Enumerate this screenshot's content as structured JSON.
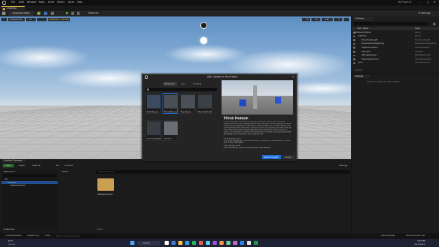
{
  "menu": {
    "items": [
      "File",
      "Edit",
      "Window",
      "Tools",
      "Build",
      "Select",
      "Actor",
      "Help"
    ],
    "project_name": "MyProject2"
  },
  "map_tab": {
    "label": "Untitled"
  },
  "main_toolbar": {
    "mode": "Selection Mode",
    "platforms": "Platforms"
  },
  "viewport": {
    "perspective": "Perspective",
    "lit": "Lit",
    "scalability": "Scalability: Cinematic",
    "grid_value": "10",
    "angle_value": "10°",
    "scale_value": "0.25",
    "speed_value": "4"
  },
  "outliner": {
    "tab": "Outliner",
    "col_label": "Item Label",
    "col_type": "Type",
    "rows": [
      {
        "label": "Untitled (Editor)",
        "type": "World"
      },
      {
        "label": "Lighting",
        "type": "Folder"
      },
      {
        "label": "DirectionalLight",
        "type": "DirectionalLight"
      },
      {
        "label": "ExponentialHeightFog",
        "type": "ExponentialHeightFog"
      },
      {
        "label": "SkyAtmosphere",
        "type": "SkyAtmosphere"
      },
      {
        "label": "SkyLight",
        "type": "SkyLight"
      },
      {
        "label": "SM_SkySphere",
        "type": "StaticMeshActor"
      },
      {
        "label": "VolumetricCloud",
        "type": "VolumetricCloud"
      },
      {
        "label": "Floor",
        "type": "StaticMeshActor"
      }
    ],
    "footer": "9 actors"
  },
  "details": {
    "tab": "Details",
    "empty": "Select an object to view details."
  },
  "content_browser": {
    "tab": "Content Browser",
    "add": "Add",
    "import": "Import",
    "save_all": "Save All",
    "path_all": "All",
    "path_content": "Content",
    "settings": "Settings",
    "tree_root": "MyProject2",
    "tree_all": "All",
    "tree_content": "Content",
    "tree_starter": "StarterContent",
    "filters": "Filters",
    "search_placeholder": "Search Content",
    "folder_name": "StarterContent",
    "item_count": "1 item",
    "collections": "Collections"
  },
  "status": {
    "content_drawer": "Content Drawer",
    "output_log": "Output Log",
    "cmd": "Cmd",
    "console_placeholder": "Enter Console Command",
    "derived_data": "Derived Data",
    "source_control": "Source Control Off"
  },
  "taskbar": {
    "weather_temp": "61°F",
    "weather_desc": "Cloudy",
    "search": "Search",
    "time": "4:07 PM",
    "date": "2/19/2024"
  },
  "dialog": {
    "title": "Add Content to the Project",
    "tabs": [
      "Blueprint",
      "C++",
      "Content"
    ],
    "active_tab": "Blueprint",
    "search_placeholder": "",
    "templates": [
      {
        "name": "First Person"
      },
      {
        "name": "Third Person"
      },
      {
        "name": "Top Down"
      },
      {
        "name": "Handheld AR"
      },
      {
        "name": "Virtual Reality"
      },
      {
        "name": "Vehicle"
      }
    ],
    "selected": "Third Person",
    "preview_title": "Third Person",
    "preview_desc": "The third person feature is a playable character where the camera is positioned behind and slightly above the character. As the character moves using mouse, keyboard, controller or virtual joystick on a touch device, the camera follows the character, observing from an over-the-shoulder point of view. This perspective emphasizes the main character and is popular in action and adventure games. The feature also includes several objects that the player can jump upon, and push around.",
    "asset_type_label": "Asset Type(s) Used:",
    "asset_types": "Animation Sequence, Animation Blueprint, Skeleton, Skeletal Mesh, Control Rig, IK Rig, Retargeter",
    "class_type_label": "Class Type(s) Used:",
    "class_types": "Pawn/Character, EnhancedInputActions, GameMode",
    "add_button": "Add to Project",
    "cancel_button": "Cancel"
  },
  "colors": {
    "accent_blue": "#1f6fd6",
    "ue_bg": "#151515",
    "panel": "#1c1c1c",
    "folder": "#c9a052"
  }
}
